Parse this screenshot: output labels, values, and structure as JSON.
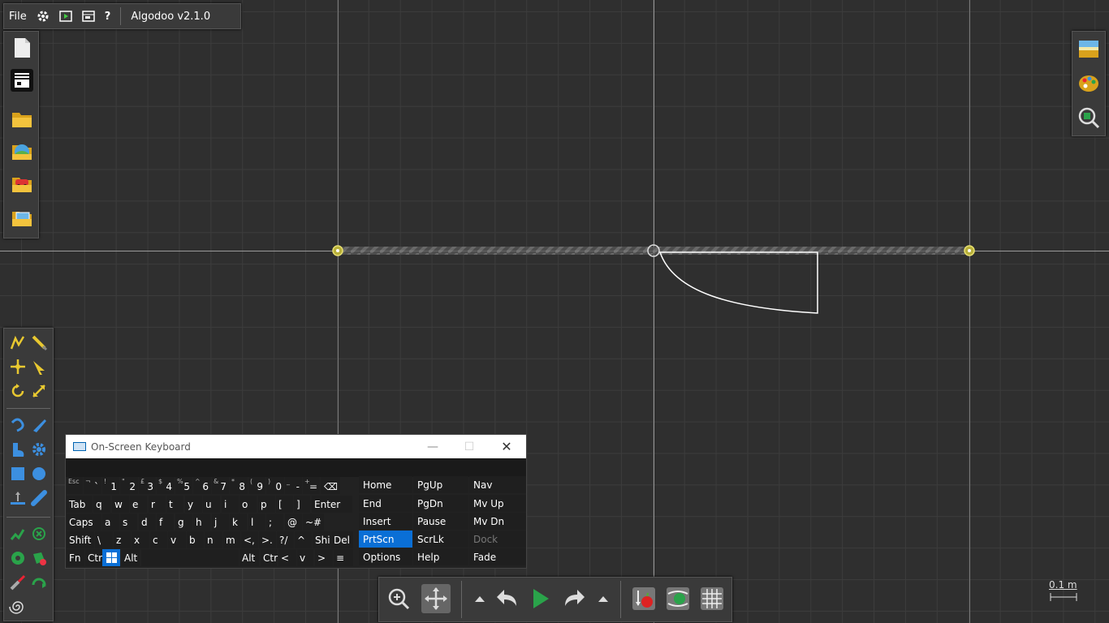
{
  "app": {
    "title": "Algodoo v2.1.0"
  },
  "menu": {
    "file": "File",
    "help": "?"
  },
  "scale_label": "0.1 m",
  "colors": {
    "accent": "#f2c12e",
    "canvas": "#2f2f2f",
    "osk_highlight": "#0a6fd6"
  },
  "icons": {
    "menu": [
      "settings-icon",
      "play-scene-icon",
      "window-icon"
    ],
    "left_panel": [
      "new-scene-icon",
      "scene-panel-icon",
      "open-folder-icon",
      "open-online-icon",
      "open-vehicle-icon",
      "open-gallery-icon"
    ],
    "right_panel": [
      "background-icon",
      "palette-icon",
      "zoom-object-icon"
    ]
  },
  "osk": {
    "title": "On-Screen Keyboard",
    "minimize": "—",
    "maximize": "☐",
    "close": "✕",
    "rows": [
      [
        {
          "sub": "Esc",
          "main": ""
        },
        {
          "sub": "¬",
          "main": "`"
        },
        {
          "sub": "!",
          "main": "1"
        },
        {
          "sub": "\"",
          "main": "2"
        },
        {
          "sub": "£",
          "main": "3"
        },
        {
          "sub": "$",
          "main": "4"
        },
        {
          "sub": "%",
          "main": "5"
        },
        {
          "sub": "^",
          "main": "6"
        },
        {
          "sub": "&",
          "main": "7"
        },
        {
          "sub": "*",
          "main": "8"
        },
        {
          "sub": "(",
          "main": "9"
        },
        {
          "sub": ")",
          "main": "0"
        },
        {
          "sub": "_",
          "main": "-"
        },
        {
          "sub": "+",
          "main": "="
        },
        {
          "sub": "",
          "main": "⌫"
        }
      ],
      [
        "Tab",
        "q",
        "w",
        "e",
        "r",
        "t",
        "y",
        "u",
        "i",
        "o",
        "p",
        "[",
        "]",
        "Enter"
      ],
      [
        "Caps",
        "a",
        "s",
        "d",
        "f",
        "g",
        "h",
        "j",
        "k",
        "l",
        ";",
        "@",
        "~#"
      ],
      [
        "Shift",
        "\\",
        "z",
        "x",
        "c",
        "v",
        "b",
        "n",
        "m",
        "<,",
        ">.",
        "?/",
        "^",
        "Shi",
        "Del"
      ],
      [
        "Fn",
        "Ctr",
        "",
        "Alt",
        "",
        "Alt",
        "Ctr",
        "<",
        "v",
        ">",
        "≡"
      ]
    ],
    "nav": [
      [
        "Home",
        "PgUp",
        "Nav"
      ],
      [
        "End",
        "PgDn",
        "Mv Up"
      ],
      [
        "Insert",
        "Pause",
        "Mv Dn"
      ],
      [
        "PrtScn",
        "ScrLk",
        "Dock"
      ],
      [
        "Options",
        "Help",
        "Fade"
      ]
    ]
  }
}
